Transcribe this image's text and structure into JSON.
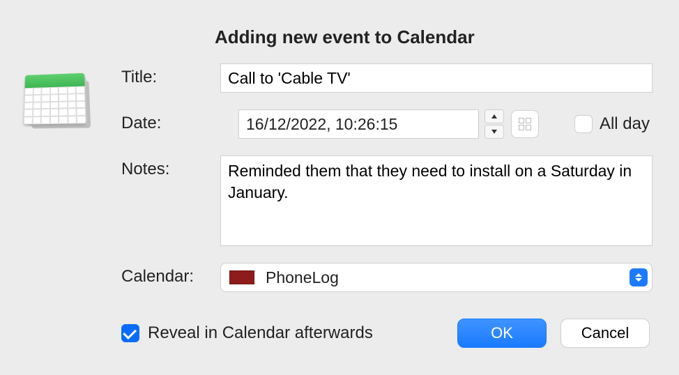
{
  "heading": "Adding new event to Calendar",
  "labels": {
    "title": "Title:",
    "date": "Date:",
    "notes": "Notes:",
    "calendar": "Calendar:",
    "all_day": "All day",
    "reveal": "Reveal in Calendar afterwards"
  },
  "fields": {
    "title_value": "Call to 'Cable TV'",
    "date_value": "16/12/2022, 10:26:15",
    "notes_value": "Reminded them that they need to install on a Saturday in January.",
    "calendar_selected": "PhoneLog",
    "calendar_color": "#8e1b1b",
    "all_day_checked": false,
    "reveal_checked": true
  },
  "buttons": {
    "ok": "OK",
    "cancel": "Cancel"
  }
}
